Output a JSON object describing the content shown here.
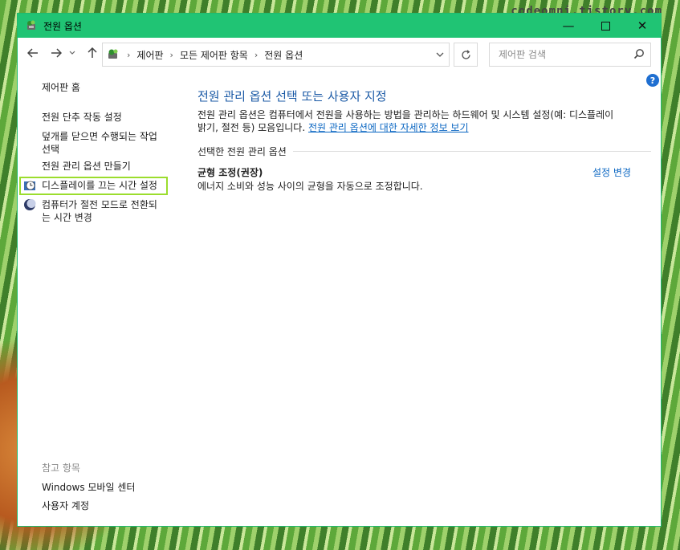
{
  "watermark": "codeomni.tistory.com",
  "window": {
    "title": "전원 옵션",
    "controls": {
      "minimize": "—",
      "maximize": "☐",
      "close": "✕"
    }
  },
  "address": {
    "crumbs": [
      "제어판",
      "모든 제어판 항목",
      "전원 옵션"
    ],
    "search_placeholder": "제어판 검색"
  },
  "sidebar": {
    "home": "제어판 홈",
    "items": [
      {
        "label": "전원 단추 작동 설정"
      },
      {
        "label_line1": "덮개를 닫으면 수행되는 작업",
        "label_line2": "선택"
      },
      {
        "label": "전원 관리 옵션 만들기"
      },
      {
        "label": "디스플레이를 끄는 시간 설정",
        "icon": "display-clock-icon",
        "highlighted": true
      },
      {
        "label_line1": "컴퓨터가 절전 모드로 전환되",
        "label_line2": "는 시간 변경",
        "icon": "moon-icon"
      }
    ],
    "see_also_title": "참고 항목",
    "see_also": [
      "Windows 모바일 센터",
      "사용자 계정"
    ]
  },
  "main": {
    "heading": "전원 관리 옵션 선택 또는 사용자 지정",
    "description_line1": "전원 관리 옵션은 컴퓨터에서 전원을 사용하는 방법을 관리하는 하드웨어 및 시스템 설정(예: 디스플레이",
    "description_line2_prefix": "밝기, 절전 등) 모음입니다.",
    "description_link": "전원 관리 옵션에 대한 자세한 정보 보기",
    "section_label": "선택한 전원 관리 옵션",
    "plan": {
      "name": "균형 조정(권장)",
      "description": "에너지 소비와 성능 사이의 균형을 자동으로 조정합니다.",
      "change_link": "설정 변경"
    }
  },
  "colors": {
    "titlebar": "#20c474",
    "heading": "#1b5aa6",
    "link": "#0a66c2",
    "highlight": "#9bdd2d"
  }
}
